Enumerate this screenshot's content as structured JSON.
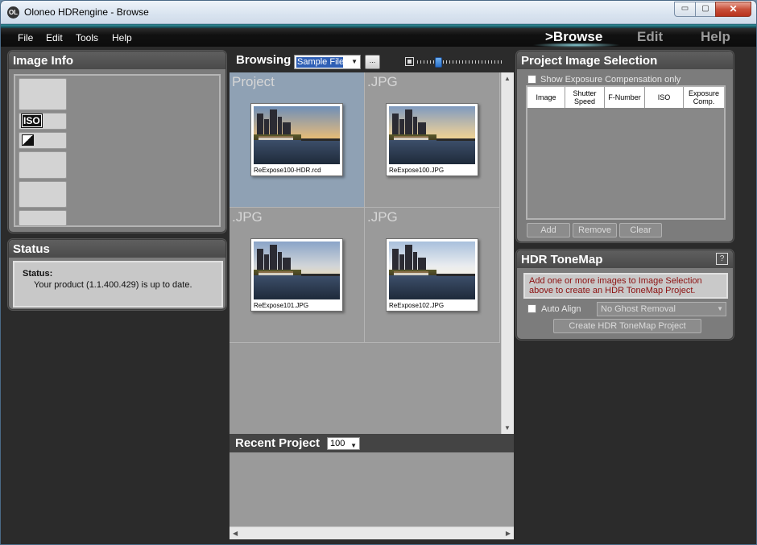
{
  "window": {
    "title": "Oloneo HDRengine - Browse",
    "app_icon": "oloneo-logo-icon",
    "icon_text": "OL",
    "minimize": "▭",
    "maximize": "▢",
    "close": "✕"
  },
  "menu": {
    "file": "File",
    "edit": "Edit",
    "tools": "Tools",
    "help": "Help"
  },
  "nav": {
    "browse": ">Browse",
    "edit": "Edit",
    "help": "Help",
    "active": "browse"
  },
  "image_info": {
    "title": "Image Info",
    "iso_label": "ISO"
  },
  "status": {
    "title": "Status",
    "label": "Status:",
    "message": "Your product (1.1.400.429) is up to date."
  },
  "browsing": {
    "title": "Browsing",
    "folder": "Sample Files\\",
    "ellipsis": "...",
    "zoom_level": 0.25,
    "items": [
      {
        "label": "Project",
        "caption": "ReExpose100-HDR.rcd",
        "selected": true
      },
      {
        "label": ".JPG",
        "caption": "ReExpose100.JPG",
        "selected": false
      },
      {
        "label": ".JPG",
        "caption": "ReExpose101.JPG",
        "selected": false
      },
      {
        "label": ".JPG",
        "caption": "ReExpose102.JPG",
        "selected": false
      }
    ]
  },
  "recent": {
    "title": "Recent Project",
    "count": "100"
  },
  "project_selection": {
    "title": "Project Image Selection",
    "show_ec_label": "Show Exposure Compensation only",
    "columns": [
      "Image",
      "Shutter Speed",
      "F-Number",
      "ISO",
      "Exposure Comp."
    ],
    "add": "Add",
    "remove": "Remove",
    "clear": "Clear"
  },
  "hdr_tonemap": {
    "title": "HDR ToneMap",
    "help": "?",
    "message": "Add one or more images to Image Selection above to create an HDR ToneMap Project.",
    "auto_align": "Auto Align",
    "ghost_option": "No Ghost Removal",
    "create": "Create HDR ToneMap Project"
  },
  "colors": {
    "menubar_accent": "#2e8c97",
    "panel_bg": "#7c7c7c",
    "selected_cell": "#8fa1b4",
    "hdr_message": "#8c1010"
  }
}
